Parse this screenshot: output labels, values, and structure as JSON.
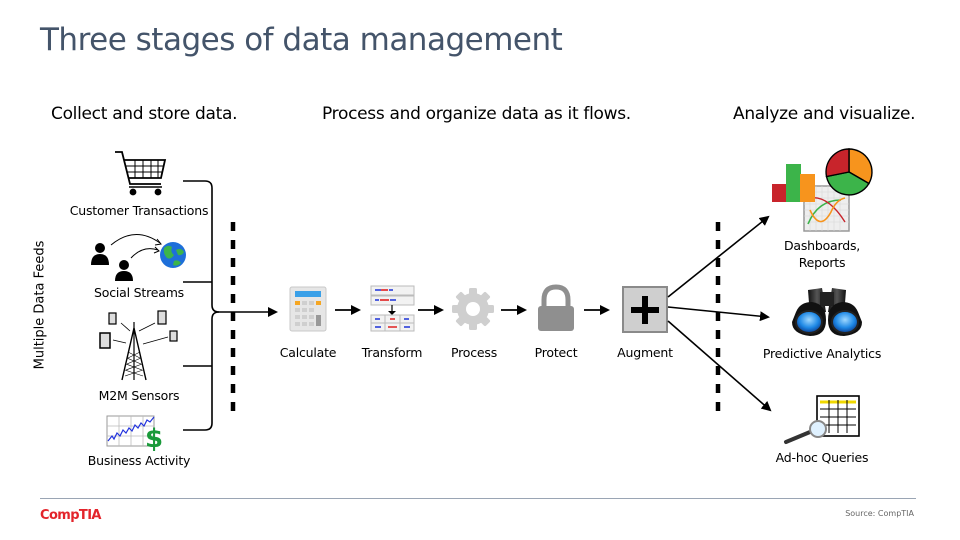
{
  "title": "Three stages of data management",
  "stages": [
    {
      "label": "Collect and store data."
    },
    {
      "label": "Process and organize data as it flows."
    },
    {
      "label": "Analyze and visualize."
    }
  ],
  "collect": {
    "group_label": "Multiple Data Feeds",
    "sources": [
      {
        "label": "Customer Transactions",
        "icon": "shopping-cart-icon"
      },
      {
        "label": "Social Streams",
        "icon": "people-globe-icon"
      },
      {
        "label": "M2M Sensors",
        "icon": "cell-tower-devices-icon"
      },
      {
        "label": "Business Activity",
        "icon": "stock-chart-dollar-icon"
      }
    ]
  },
  "process": {
    "steps": [
      {
        "label": "Calculate",
        "icon": "calculator-icon"
      },
      {
        "label": "Transform",
        "icon": "table-transform-icon"
      },
      {
        "label": "Process",
        "icon": "gear-icon"
      },
      {
        "label": "Protect",
        "icon": "lock-icon"
      },
      {
        "label": "Augment",
        "icon": "plus-box-icon"
      }
    ]
  },
  "analyze": {
    "outputs": [
      {
        "label_line1": "Dashboards,",
        "label_line2": "Reports",
        "icon": "dashboard-charts-icon"
      },
      {
        "label": "Predictive Analytics",
        "icon": "binoculars-icon"
      },
      {
        "label": "Ad-hoc Queries",
        "icon": "grid-magnifier-icon"
      }
    ]
  },
  "colors": {
    "title": "#44546a",
    "brand": "#e3242b",
    "red": "#c8242b",
    "green": "#3cb44a",
    "orange": "#f7941d",
    "blue": "#1e6fd9"
  },
  "footer": {
    "logo": "CompTIA",
    "source": "Source: CompTIA"
  }
}
